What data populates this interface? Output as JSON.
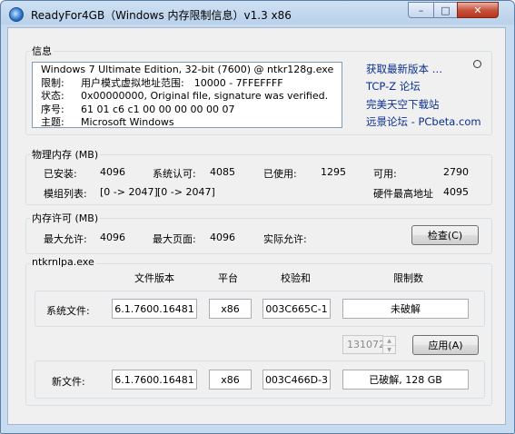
{
  "window": {
    "title": "ReadyFor4GB（Windows 内存限制信息）v1.3 x86",
    "buttons": {
      "minimize": "–",
      "maximize": "□",
      "close": "✕"
    }
  },
  "info": {
    "title": "信息",
    "rows": [
      {
        "key": "",
        "value": "Windows 7 Ultimate Edition, 32-bit (7600) @ ntkr128g.exe"
      },
      {
        "key": "限制:",
        "value": "用户模式虚拟地址范围:　10000 - 7FFEFFFF"
      },
      {
        "key": "状态:",
        "value": "0x00000000, Original file, signature was verified."
      },
      {
        "key": "序号:",
        "value": "61 01 c6 c1 00 00 00 00 00 07"
      },
      {
        "key": "主题:",
        "value": "Microsoft Windows"
      }
    ],
    "links": [
      "获取最新版本 …",
      "TCP-Z 论坛",
      "完美天空下载站",
      "远景论坛 - PCbeta.com"
    ]
  },
  "physical": {
    "title": "物理内存 (MB)",
    "installed_label": "已安装:",
    "installed_value": "4096",
    "system_label": "系统认可:",
    "system_value": "4085",
    "used_label": "已使用:",
    "used_value": "1295",
    "available_label": "可用:",
    "available_value": "2790",
    "modules_label": "模组列表:",
    "modules_value1": "[0 -> 2047]",
    "modules_value2": "[0 -> 2047]",
    "hw_max_label": "硬件最高地址",
    "hw_max_value": "4095"
  },
  "commit": {
    "title": "内存许可 (MB)",
    "max_commit_label": "最大允许:",
    "max_commit_value": "4096",
    "max_page_label": "最大页面:",
    "max_page_value": "4096",
    "actual_label": "实际允许:",
    "actual_value": "",
    "check_button": "检查(C)"
  },
  "kernel": {
    "title": "ntkrnlpa.exe",
    "headers": {
      "version": "文件版本",
      "platform": "平台",
      "checksum": "校验和",
      "limit": "限制数"
    },
    "system_file": {
      "label": "系统文件:",
      "version": "6.1.7600.16481",
      "platform": "x86",
      "checksum": "003C665C-1",
      "limit": "未破解"
    },
    "limit_spin_value": "131072",
    "apply_button": "应用(A)",
    "new_file": {
      "label": "新文件:",
      "version": "6.1.7600.16481",
      "platform": "x86",
      "checksum": "003C466D-3",
      "limit": "已破解, 128 GB"
    }
  }
}
